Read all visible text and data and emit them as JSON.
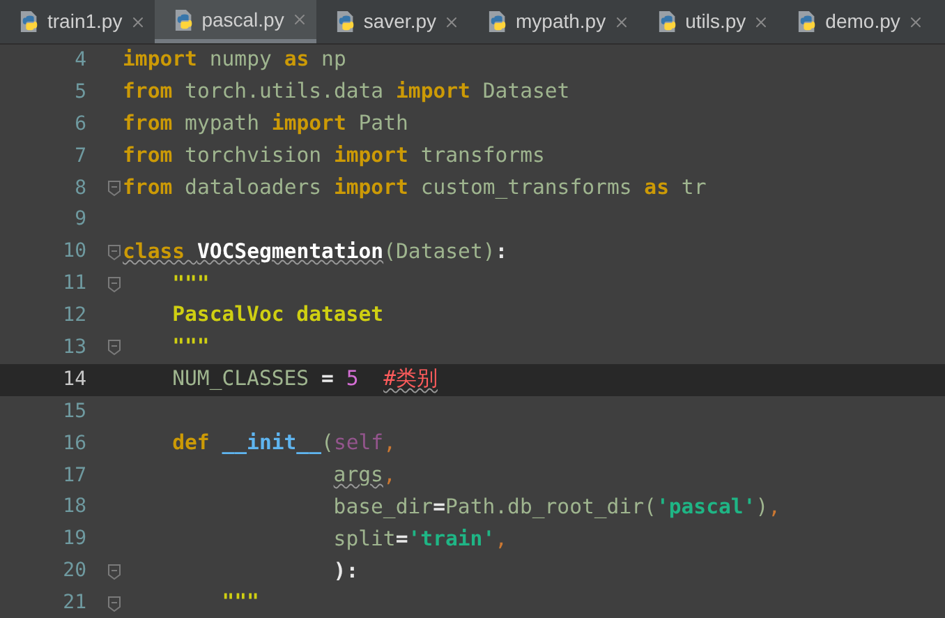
{
  "tabs": [
    {
      "label": "train1.py",
      "selected": false
    },
    {
      "label": "pascal.py",
      "selected": true
    },
    {
      "label": "saver.py",
      "selected": false
    },
    {
      "label": "mypath.py",
      "selected": false
    },
    {
      "label": "utils.py",
      "selected": false
    },
    {
      "label": "demo.py",
      "selected": false
    }
  ],
  "lines": [
    {
      "number": "4",
      "kind": "top",
      "current": false,
      "fold": false,
      "tokens": [
        {
          "text": "import ",
          "kind": "kw",
          "squiggly": false
        },
        {
          "text": "numpy ",
          "kind": "id",
          "squiggly": false
        },
        {
          "text": "as ",
          "kind": "kw",
          "squiggly": false
        },
        {
          "text": "np",
          "kind": "id",
          "squiggly": false
        }
      ]
    },
    {
      "number": "5",
      "kind": "top",
      "current": false,
      "fold": false,
      "tokens": [
        {
          "text": "from ",
          "kind": "kw",
          "squiggly": false
        },
        {
          "text": "torch.utils.data ",
          "kind": "id",
          "squiggly": false
        },
        {
          "text": "import ",
          "kind": "kw",
          "squiggly": false
        },
        {
          "text": "Dataset",
          "kind": "id",
          "squiggly": false
        }
      ]
    },
    {
      "number": "6",
      "kind": "top",
      "current": false,
      "fold": false,
      "tokens": [
        {
          "text": "from ",
          "kind": "kw",
          "squiggly": false
        },
        {
          "text": "mypath ",
          "kind": "id",
          "squiggly": false
        },
        {
          "text": "import ",
          "kind": "kw",
          "squiggly": false
        },
        {
          "text": "Path",
          "kind": "id",
          "squiggly": false
        }
      ]
    },
    {
      "number": "7",
      "kind": "top",
      "current": false,
      "fold": false,
      "tokens": [
        {
          "text": "from ",
          "kind": "kw",
          "squiggly": false
        },
        {
          "text": "torchvision ",
          "kind": "id",
          "squiggly": false
        },
        {
          "text": "import ",
          "kind": "kw",
          "squiggly": false
        },
        {
          "text": "transforms",
          "kind": "id",
          "squiggly": false
        }
      ]
    },
    {
      "number": "8",
      "kind": "top",
      "current": false,
      "fold": true,
      "tokens": [
        {
          "text": "from ",
          "kind": "kw",
          "squiggly": false
        },
        {
          "text": "dataloaders ",
          "kind": "id",
          "squiggly": false
        },
        {
          "text": "import ",
          "kind": "kw",
          "squiggly": false
        },
        {
          "text": "custom_transforms ",
          "kind": "id",
          "squiggly": false
        },
        {
          "text": "as ",
          "kind": "kw",
          "squiggly": false
        },
        {
          "text": "tr",
          "kind": "id",
          "squiggly": false
        }
      ]
    },
    {
      "number": "9",
      "current": false,
      "fold": false
    },
    {
      "number": "10",
      "kind": "top",
      "current": false,
      "fold": true,
      "tokens": [
        {
          "text": "class ",
          "kind": "kw",
          "squiggly": true
        },
        {
          "text": "VOCSegmentation",
          "kind": "cls",
          "squiggly": true
        },
        {
          "text": "(Dataset)",
          "kind": "id",
          "squiggly": false
        },
        {
          "text": ":",
          "kind": "op",
          "squiggly": false
        }
      ]
    },
    {
      "number": "11",
      "kind": "body",
      "current": false,
      "fold": true,
      "tokens": [
        {
          "text": "\"\"\"",
          "kind": "doc",
          "squiggly": false
        }
      ]
    },
    {
      "number": "12",
      "kind": "body",
      "current": false,
      "fold": false,
      "tokens": [
        {
          "text": "PascalVoc dataset",
          "kind": "doc",
          "squiggly": false
        }
      ]
    },
    {
      "number": "13",
      "kind": "body",
      "current": false,
      "fold": true,
      "tokens": [
        {
          "text": "\"\"\"",
          "kind": "doc",
          "squiggly": false
        }
      ]
    },
    {
      "number": "14",
      "kind": "body",
      "current": true,
      "fold": false,
      "tokens": [
        {
          "text": "NUM_CLASSES ",
          "kind": "id",
          "squiggly": false
        },
        {
          "text": "= ",
          "kind": "op",
          "squiggly": false
        },
        {
          "text": "5  ",
          "kind": "num",
          "squiggly": false
        },
        {
          "text": "#类别",
          "kind": "comment",
          "squiggly": true
        }
      ]
    },
    {
      "number": "15",
      "current": false,
      "fold": false
    },
    {
      "number": "16",
      "kind": "body",
      "current": false,
      "fold": false,
      "tokens": [
        {
          "text": "def ",
          "kind": "kw",
          "squiggly": false
        },
        {
          "text": "__init__",
          "kind": "fn",
          "squiggly": false
        },
        {
          "text": "(",
          "kind": "id",
          "squiggly": false
        },
        {
          "text": "self",
          "kind": "self",
          "squiggly": false
        },
        {
          "text": ",",
          "kind": "comma",
          "squiggly": false
        }
      ]
    },
    {
      "number": "17",
      "kind": "args",
      "current": false,
      "fold": false,
      "tokens": [
        {
          "text": "args",
          "kind": "id",
          "squiggly": true
        },
        {
          "text": ",",
          "kind": "comma",
          "squiggly": false
        }
      ]
    },
    {
      "number": "18",
      "kind": "args",
      "current": false,
      "fold": false,
      "tokens": [
        {
          "text": "base_dir",
          "kind": "id",
          "squiggly": false
        },
        {
          "text": "=",
          "kind": "op",
          "squiggly": false
        },
        {
          "text": "Path.db_root_dir(",
          "kind": "id",
          "squiggly": false
        },
        {
          "text": "'pascal'",
          "kind": "str",
          "squiggly": false
        },
        {
          "text": ")",
          "kind": "id",
          "squiggly": false
        },
        {
          "text": ",",
          "kind": "comma",
          "squiggly": false
        }
      ]
    },
    {
      "number": "19",
      "kind": "args",
      "current": false,
      "fold": false,
      "tokens": [
        {
          "text": "split",
          "kind": "id",
          "squiggly": false
        },
        {
          "text": "=",
          "kind": "op",
          "squiggly": false
        },
        {
          "text": "'train'",
          "kind": "str",
          "squiggly": false
        },
        {
          "text": ",",
          "kind": "comma",
          "squiggly": false
        }
      ]
    },
    {
      "number": "20",
      "kind": "args",
      "current": false,
      "fold": true,
      "tokens": [
        {
          "text": "):",
          "kind": "op",
          "squiggly": false
        }
      ]
    },
    {
      "number": "21",
      "kind": "inner",
      "current": false,
      "fold": true,
      "tokens": [
        {
          "text": "\"\"\"",
          "kind": "doc",
          "squiggly": false
        }
      ]
    }
  ]
}
